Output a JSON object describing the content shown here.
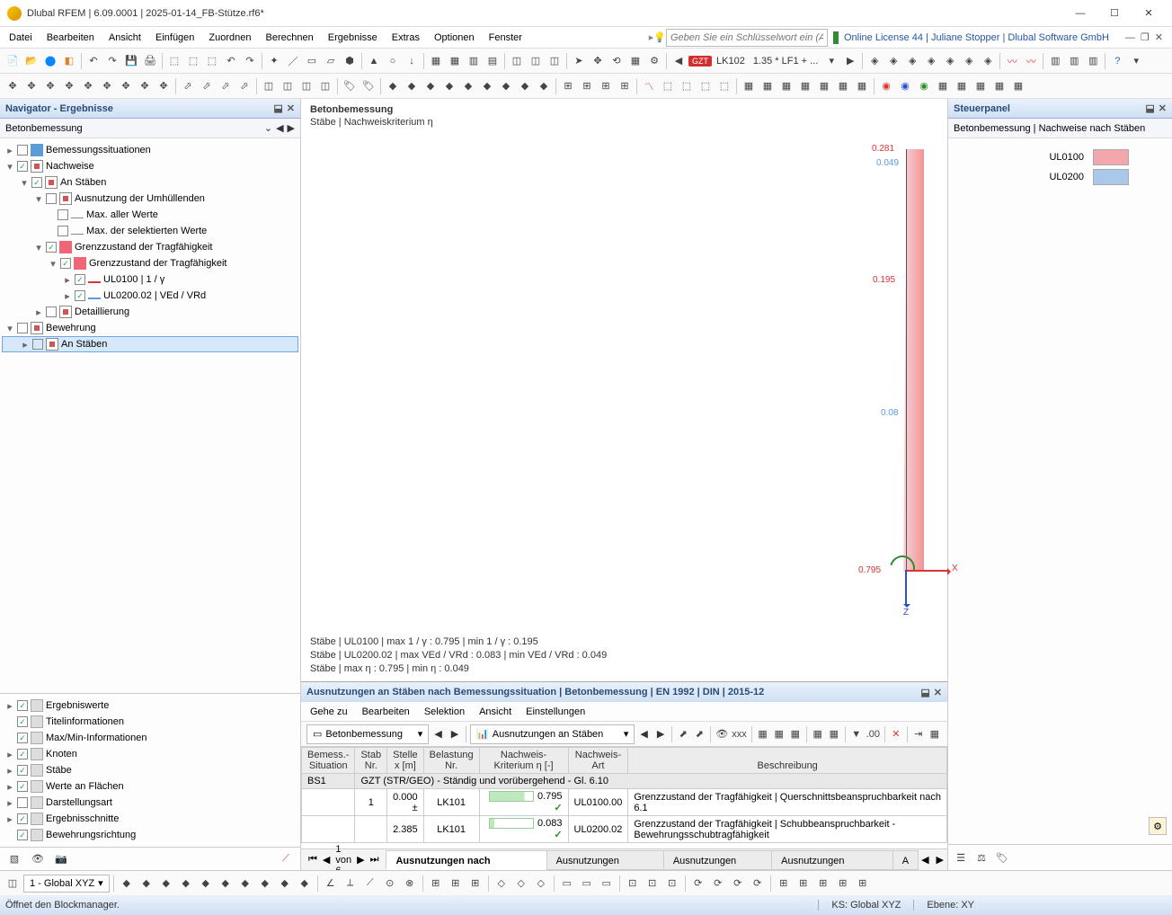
{
  "window": {
    "title": "Dlubal RFEM | 6.09.0001 | 2025-01-14_FB-Stütze.rf6*"
  },
  "menu": {
    "items": [
      "Datei",
      "Bearbeiten",
      "Ansicht",
      "Einfügen",
      "Zuordnen",
      "Berechnen",
      "Ergebnisse",
      "Extras",
      "Optionen",
      "Fenster"
    ],
    "search_placeholder": "Geben Sie ein Schlüsselwort ein (Alt...",
    "license": "Online License 44 | Juliane Stopper | Dlubal Software GmbH"
  },
  "toolbar2": {
    "badge": "GZT",
    "lk": "LK102",
    "combo": "1.35 * LF1 + ..."
  },
  "navigator": {
    "title": "Navigator - Ergebnisse",
    "subtitle": "Betonbemessung",
    "tree": {
      "bemessungssituationen": "Bemessungssituationen",
      "nachweise": "Nachweise",
      "an_staben": "An Stäben",
      "ausnutzung": "Ausnutzung der Umhüllenden",
      "max_aller": "Max. aller Werte",
      "max_sel": "Max. der selektierten Werte",
      "gzt1": "Grenzzustand der Tragfähigkeit",
      "gzt2": "Grenzzustand der Tragfähigkeit",
      "ul0100": "UL0100 | 1 / γ",
      "ul0200": "UL0200.02 | VEd / VRd",
      "detail": "Detaillierung",
      "bewehrung": "Bewehrung",
      "an_staben2": "An Stäben"
    },
    "options": [
      "Ergebniswerte",
      "Titelinformationen",
      "Max/Min-Informationen",
      "Knoten",
      "Stäbe",
      "Werte an Flächen",
      "Darstellungsart",
      "Ergebnisschnitte",
      "Bewehrungsrichtung"
    ]
  },
  "viewport": {
    "title": "Betonbemessung",
    "subtitle": "Stäbe | Nachweiskriterium η",
    "labels": {
      "top1": "0.281",
      "top2": "0.049",
      "mid": "0.195",
      "low": "0.08",
      "bottom": "0.795",
      "x": "X",
      "z": "Z"
    },
    "footer": [
      "Stäbe | UL0100 | max 1 / γ : 0.795 | min 1 / γ : 0.195",
      "Stäbe | UL0200.02 | max VEd / VRd : 0.083 | min VEd / VRd : 0.049",
      "Stäbe | max η : 0.795 | min η : 0.049"
    ]
  },
  "steuer": {
    "title": "Steuerpanel",
    "subtitle": "Betonbemessung | Nachweise nach Stäben",
    "legend": [
      {
        "name": "UL0100",
        "color": "#f3a6ab"
      },
      {
        "name": "UL0200",
        "color": "#a9c8ea"
      }
    ]
  },
  "table": {
    "title": "Ausnutzungen an Stäben nach Bemessungssituation | Betonbemessung | EN 1992 | DIN | 2015-12",
    "menu": [
      "Gehe zu",
      "Bearbeiten",
      "Selektion",
      "Ansicht",
      "Einstellungen"
    ],
    "sel1": "Betonbemessung",
    "sel2": "Ausnutzungen an Stäben",
    "headers": {
      "c1a": "Bemess.-",
      "c1b": "Situation",
      "c2a": "Stab",
      "c2b": "Nr.",
      "c3a": "Stelle",
      "c3b": "x [m]",
      "c4a": "Belastung",
      "c4b": "Nr.",
      "c5a": "Nachweis-",
      "c5b": "Kriterium η [-]",
      "c6a": "Nachweis-",
      "c6b": "Art",
      "c7": "Beschreibung"
    },
    "group": {
      "id": "BS1",
      "text": "GZT (STR/GEO) - Ständig und vorübergehend - Gl. 6.10"
    },
    "rows": [
      {
        "stab": "1",
        "x": "0.000",
        "mark": "±",
        "lk": "LK101",
        "ratio": "0.795",
        "art": "UL0100.00",
        "desc": "Grenzzustand der Tragfähigkeit | Querschnittsbeanspruchbarkeit nach 6.1"
      },
      {
        "stab": "",
        "x": "2.385",
        "mark": "",
        "lk": "LK101",
        "ratio": "0.083",
        "art": "UL0200.02",
        "desc": "Grenzzustand der Tragfähigkeit | Schubbeanspruchbarkeit - Bewehrungsschubtragfähigkeit"
      }
    ],
    "pager": "1 von 6",
    "tabs": [
      "Ausnutzungen nach Bemessungssituation",
      "Ausnutzungen belastungsweise",
      "Ausnutzungen materialweise",
      "Ausnutzungen querschnittsweise"
    ],
    "tab_end": "A"
  },
  "status_toolbar": {
    "coord": "1 - Global XYZ"
  },
  "status": {
    "hint": "Öffnet den Blockmanager.",
    "ks": "KS: Global XYZ",
    "ebene": "Ebene: XY"
  }
}
